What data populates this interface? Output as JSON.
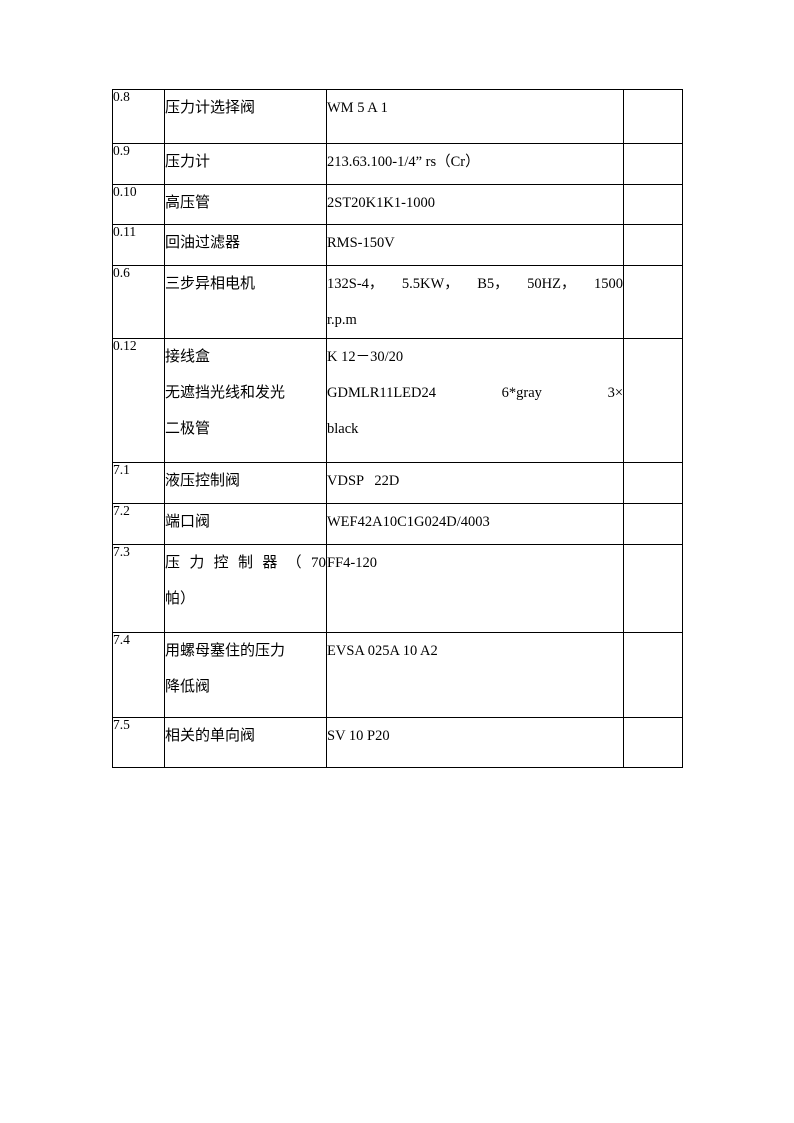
{
  "document": {
    "type": "specification-table",
    "background_color": "#ffffff",
    "border_color": "#000000",
    "text_color": "#000000"
  },
  "table": {
    "columns": [
      "index",
      "name",
      "model",
      "note"
    ],
    "rows": [
      {
        "index": "0.8",
        "name_lines": [
          "压力计选择阀"
        ],
        "model_lines": [
          "WM 5 A 1"
        ],
        "note": ""
      },
      {
        "index": "0.9",
        "name_lines": [
          "压力计"
        ],
        "model_lines": [
          "213.63.100-1/4” rs（Cr）"
        ],
        "note": ""
      },
      {
        "index": "0.10",
        "name_lines": [
          "高压管"
        ],
        "model_lines": [
          "2ST20K1K1-1000"
        ],
        "note": ""
      },
      {
        "index": "0.11",
        "name_lines": [
          "回油过滤器"
        ],
        "model_lines": [
          "RMS-150V"
        ],
        "note": ""
      },
      {
        "index": "0.6",
        "name_lines": [
          "三步异相电机"
        ],
        "model_lines": [
          "132S-4，5.5KW，B5，50HZ，  1500",
          "r.p.m"
        ],
        "model_line_spread": [
          true,
          false
        ],
        "model_spread_parts": [
          [
            "132S-4，",
            "5.5KW，",
            "B5，",
            "50HZ，",
            "1500"
          ]
        ],
        "note": ""
      },
      {
        "index": "0.12",
        "name_lines": [
          "接线盒",
          "无遮挡光线和发光",
          "二极管"
        ],
        "model_lines": [
          "K 12－30/20",
          "GDMLR11LED24     6*gray     3×",
          "black"
        ],
        "model_line_spread": [
          false,
          true,
          false
        ],
        "model_spread_parts": [
          [
            "GDMLR11LED24",
            "6*gray",
            "3×"
          ]
        ],
        "note": ""
      },
      {
        "index": "7.1",
        "name_lines": [
          "液压控制阀"
        ],
        "model_lines": [
          "VDSP   22D"
        ],
        "note": ""
      },
      {
        "index": "7.2",
        "name_lines": [
          "端口阀"
        ],
        "model_lines": [
          "WEF42A10C1G024D/4003"
        ],
        "note": ""
      },
      {
        "index": "7.3",
        "name_lines": [
          "压力控制器（70",
          "帕）"
        ],
        "name_line_justify": [
          true,
          false
        ],
        "name_justify_parts": [
          [
            "压",
            "力",
            "控",
            "制",
            "器",
            "（",
            "70"
          ]
        ],
        "model_lines": [
          "FF4-120"
        ],
        "note": ""
      },
      {
        "index": "7.4",
        "name_lines": [
          "用螺母塞住的压力",
          "降低阀"
        ],
        "model_lines": [
          "EVSA 025A 10 A2"
        ],
        "note": ""
      },
      {
        "index": "7.5",
        "name_lines": [
          "相关的单向阀"
        ],
        "model_lines": [
          "SV 10 P20"
        ],
        "note": ""
      }
    ]
  }
}
